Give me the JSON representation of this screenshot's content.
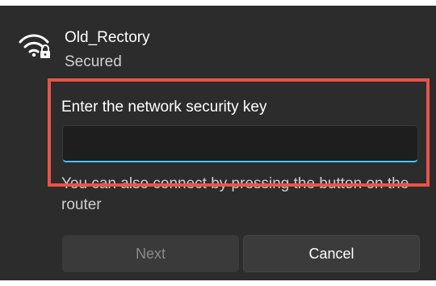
{
  "network": {
    "icon": "wifi-secured-icon",
    "ssid": "Old_Rectory",
    "status": "Secured"
  },
  "security_key": {
    "prompt": "Enter the network security key",
    "value": "",
    "placeholder": ""
  },
  "router_hint": "You can also connect by pressing the button on the router",
  "buttons": {
    "next_label": "Next",
    "cancel_label": "Cancel"
  },
  "colors": {
    "panel_background": "#2c2c2c",
    "input_focus_underline": "#4cc2ff",
    "highlight_border": "#e9534a"
  }
}
